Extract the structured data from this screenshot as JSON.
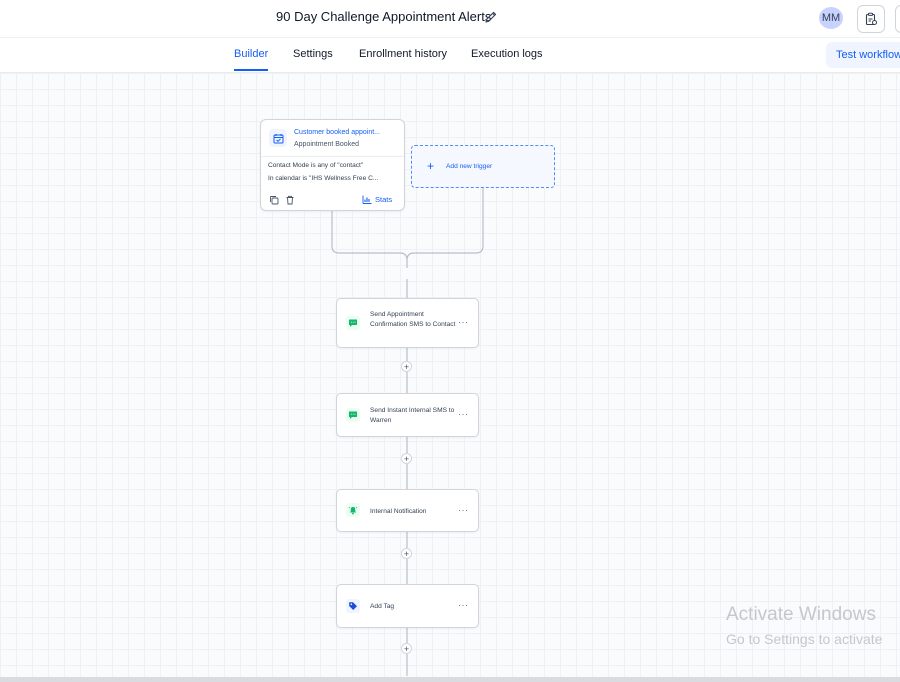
{
  "header": {
    "workflow_title": "90 Day Challenge Appointment Alerts",
    "edit_icon": "pencil-icon",
    "avatar_initials": "MM"
  },
  "tabs": [
    {
      "label": "Builder",
      "active": true
    },
    {
      "label": "Settings",
      "active": false
    },
    {
      "label": "Enrollment history",
      "active": false
    },
    {
      "label": "Execution logs",
      "active": false
    }
  ],
  "test_button_label": "Test workflow",
  "trigger": {
    "title": "Customer booked appoint...",
    "subtitle": "Appointment Booked",
    "conditions": [
      "Contact Mode is any of \"contact\"",
      "In calendar is \"IHS Wellness Free C..."
    ],
    "stats_label": "Stats"
  },
  "add_trigger_label": "Add new trigger",
  "actions": [
    {
      "label": "Send Appointment Confirmation SMS to Contact",
      "icon": "sms-icon"
    },
    {
      "label": "Send Instant Internal SMS to Warren",
      "icon": "sms-icon"
    },
    {
      "label": "Internal Notification",
      "icon": "bell-icon"
    },
    {
      "label": "Add Tag",
      "icon": "tag-icon"
    }
  ],
  "more_label": "···",
  "add_step_symbol": "+",
  "watermark": {
    "line1": "Activate Windows",
    "line2": "Go to Settings to activate"
  },
  "colors": {
    "accent": "#155eef",
    "sms_icon": "#12b76a",
    "tag_icon": "#1d4ed8",
    "border": "#d0d5dd"
  }
}
